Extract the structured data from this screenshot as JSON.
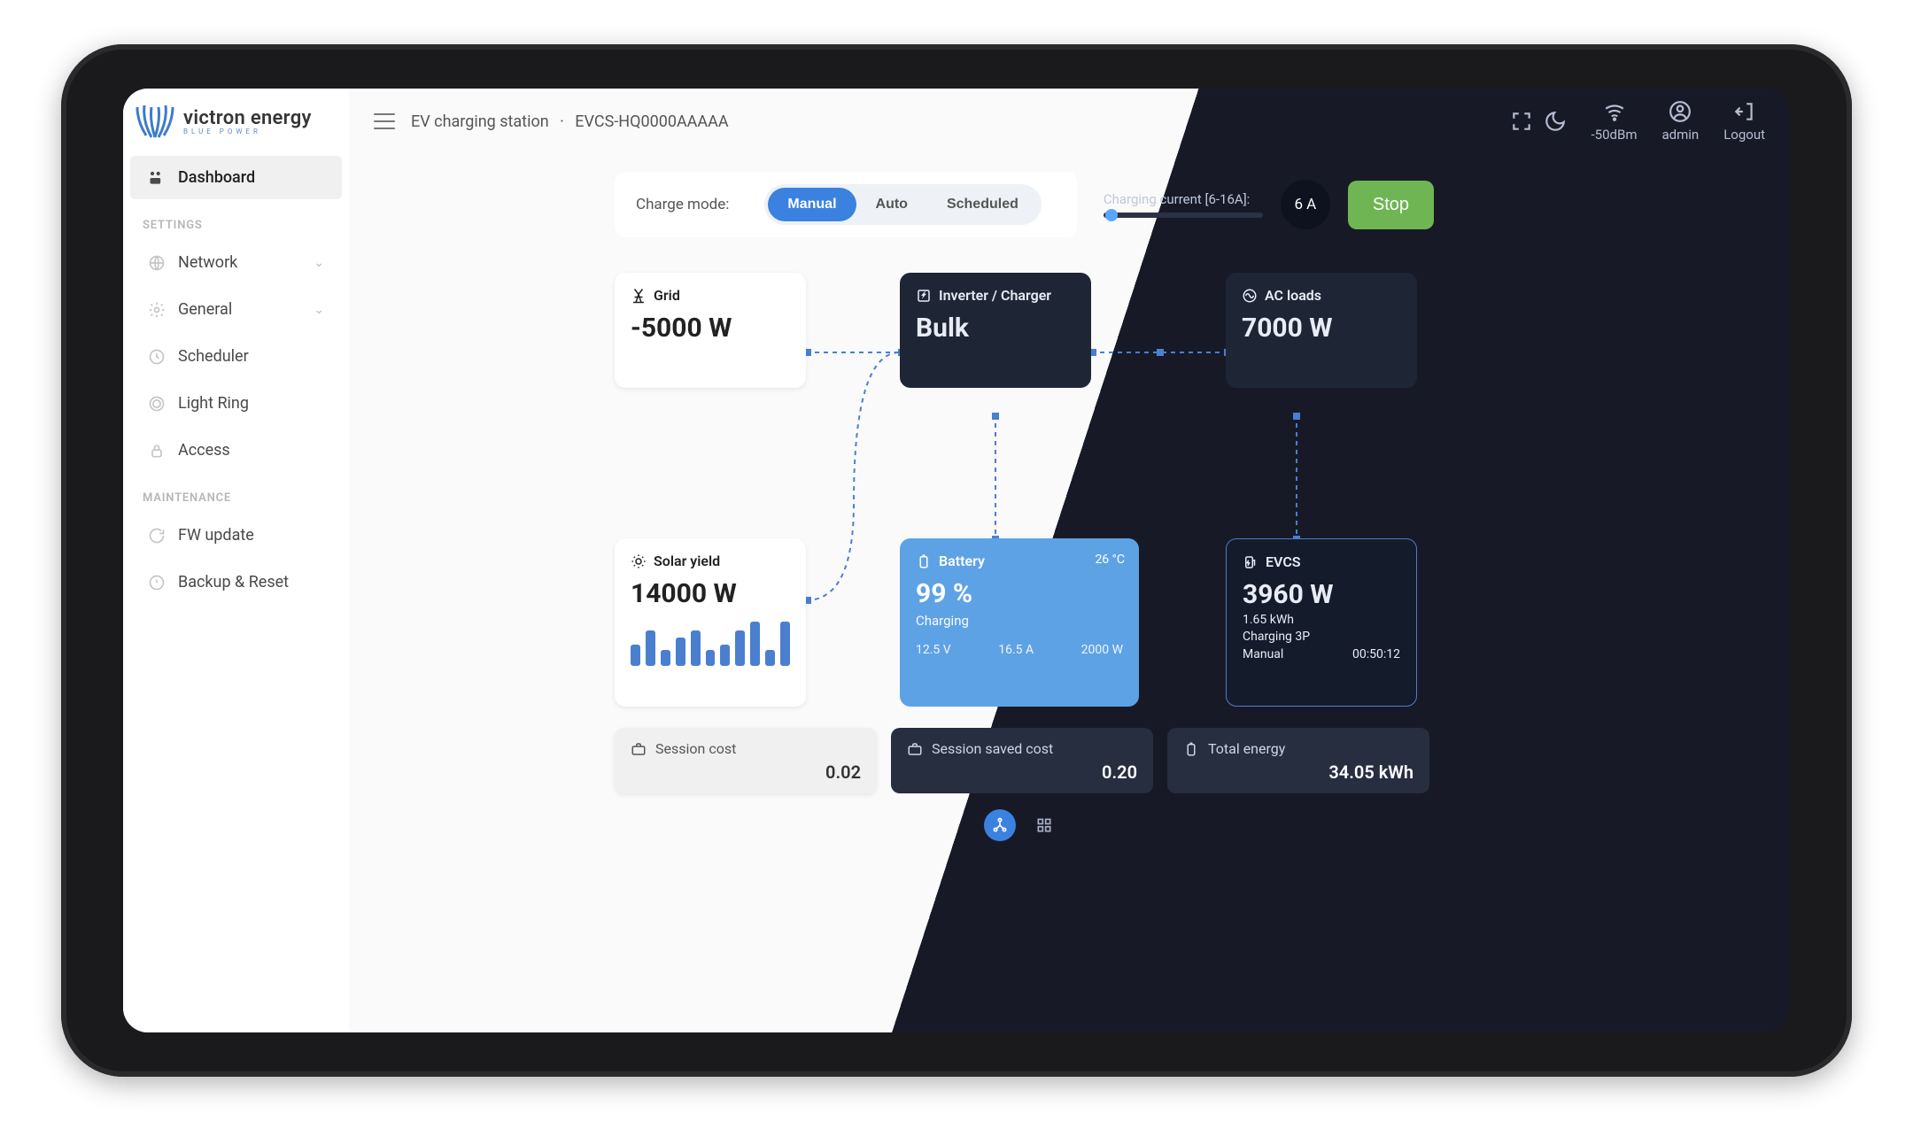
{
  "brand": {
    "name": "victron energy",
    "tagline": "BLUE POWER"
  },
  "breadcrumb": {
    "page": "EV charging station",
    "device": "EVCS-HQ0000AAAAA"
  },
  "topbar": {
    "signal": "-50dBm",
    "user": "admin",
    "logout": "Logout"
  },
  "sidebar": {
    "dashboard": "Dashboard",
    "sections": {
      "settings_label": "SETTINGS",
      "maintenance_label": "MAINTENANCE"
    },
    "items": {
      "network": "Network",
      "general": "General",
      "scheduler": "Scheduler",
      "light_ring": "Light Ring",
      "access": "Access",
      "fw_update": "FW update",
      "backup_reset": "Backup & Reset"
    }
  },
  "controls": {
    "charge_mode_label": "Charge mode:",
    "modes": {
      "manual": "Manual",
      "auto": "Auto",
      "scheduled": "Scheduled"
    },
    "active_mode": "manual",
    "cc_label": "Charging current [6-16A]:",
    "cc_value": "6",
    "cc_unit": "A",
    "stop": "Stop"
  },
  "cards": {
    "grid": {
      "title": "Grid",
      "value": "-5000 W"
    },
    "inverter": {
      "title": "Inverter / Charger",
      "value": "Bulk"
    },
    "ac_loads": {
      "title": "AC loads",
      "value": "7000 W"
    },
    "solar": {
      "title": "Solar yield",
      "value": "14000 W",
      "spark": [
        24,
        40,
        18,
        32,
        40,
        18,
        24,
        40,
        50,
        18,
        50
      ]
    },
    "battery": {
      "title": "Battery",
      "temp": "26 °C",
      "soc": "99 %",
      "state": "Charging",
      "v": "12.5 V",
      "a": "16.5 A",
      "w": "2000 W"
    },
    "evcs": {
      "title": "EVCS",
      "power": "3960 W",
      "energy": "1.65 kWh",
      "state": "Charging 3P",
      "mode": "Manual",
      "time": "00:50:12"
    }
  },
  "stats": {
    "session_cost": {
      "label": "Session cost",
      "value": "0.02"
    },
    "session_saved": {
      "label": "Session saved cost",
      "value": "0.20"
    },
    "total_energy": {
      "label": "Total energy",
      "value": "34.05 kWh"
    }
  }
}
